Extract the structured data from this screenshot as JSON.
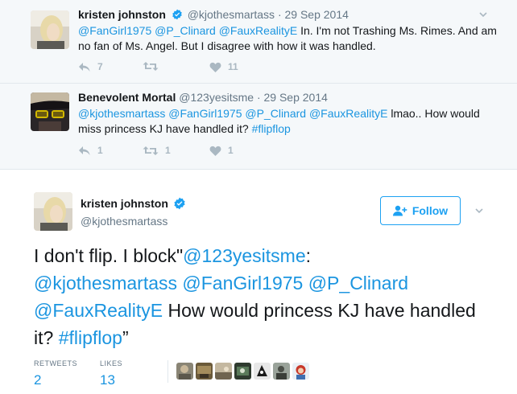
{
  "context_tweets": [
    {
      "name": "kristen johnston",
      "handle": "@kjothesmartass",
      "date": "· 29 Sep 2014",
      "mentions": "@FanGirl1975 @P_Clinard @FauxRealityE",
      "text": " In. I'm not Trashing Ms. Rimes. And am no fan of Ms. Angel. But I disagree with how it was handled.",
      "replies": "7",
      "retweets": "",
      "likes": "11",
      "verified": true
    },
    {
      "name": "Benevolent Mortal",
      "handle": "@123yesitsme",
      "date": "· 29 Sep 2014",
      "mentions": "@kjothesmartass @FanGirl1975 @P_Clinard @FauxRealityE",
      "text_a": "  lmao.. How would miss princess KJ have handled it? ",
      "hashtag": "#flipflop",
      "replies": "1",
      "retweets": "1",
      "likes": "1",
      "verified": false
    }
  ],
  "main_tweet": {
    "name": "kristen johnston",
    "handle": "@kjothesmartass",
    "follow_label": "Follow",
    "text_1": "I don't flip. I block\"",
    "link_1": "@123yesitsme",
    "text_2": ":",
    "mentions": "@kjothesmartass @FanGirl1975 @P_Clinard @FauxRealityE",
    "text_3": "  How would princess KJ have handled it? ",
    "hashtag": "#flipflop",
    "text_4": "”",
    "retweets_label": "RETWEETS",
    "retweets_value": "2",
    "likes_label": "LIKES",
    "likes_value": "13"
  },
  "colors": {
    "link": "#1b95e0",
    "verified": "#1da1f2",
    "muted": "#657786",
    "action_icon": "#aab8c2",
    "context_bg": "#f5f8fa"
  },
  "icons": [
    "reply-icon",
    "retweet-icon",
    "heart-icon",
    "chevron-down-icon",
    "verified-badge-icon",
    "follow-person-icon"
  ]
}
